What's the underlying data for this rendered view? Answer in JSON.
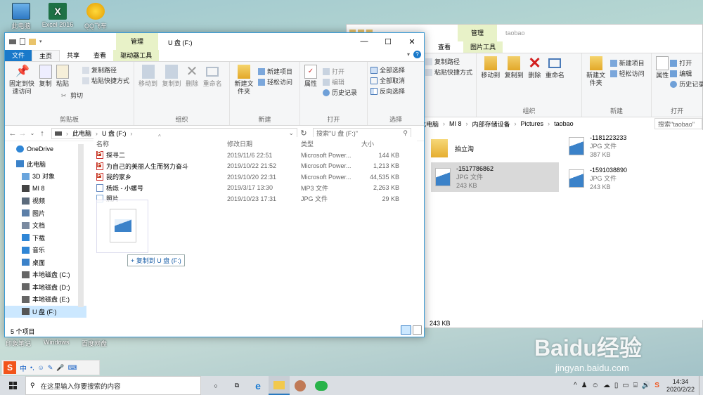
{
  "desktop": {
    "icons": [
      {
        "label": "此电脑"
      },
      {
        "label": "Excel 2016"
      },
      {
        "label": "QQ飞车"
      }
    ],
    "bottom_labels": [
      "印象笔记",
      "Windows",
      "百度网盘"
    ]
  },
  "front_window": {
    "quick_title": "U 盘 (F:)",
    "context_tab": "管理",
    "tabs": [
      "文件",
      "主页",
      "共享",
      "查看",
      "驱动器工具"
    ],
    "ribbon": {
      "clipboard": {
        "pin": "固定到快速访问",
        "copy": "复制",
        "paste": "粘贴",
        "copy_path": "复制路径",
        "paste_shortcut": "粘贴快捷方式",
        "cut": "剪切",
        "label": "剪贴板"
      },
      "organize": {
        "move_to": "移动到",
        "copy_to": "复制到",
        "delete": "删除",
        "rename": "重命名",
        "label": "组织"
      },
      "new": {
        "new_folder": "新建文件夹",
        "new_item": "新建项目",
        "easy_access": "轻松访问",
        "label": "新建"
      },
      "open": {
        "properties": "属性",
        "open": "打开",
        "edit": "编辑",
        "history": "历史记录",
        "label": "打开"
      },
      "select": {
        "select_all": "全部选择",
        "select_none": "全部取消",
        "invert": "反向选择",
        "label": "选择"
      }
    },
    "address": {
      "parts": [
        "此电脑",
        "U 盘 (F:)"
      ],
      "search_placeholder": "搜索\"U 盘 (F:)\""
    },
    "nav": [
      {
        "label": "OneDrive",
        "icon": "cloud-icon"
      },
      {
        "label": "此电脑",
        "icon": "pc-icon"
      },
      {
        "label": "3D 对象",
        "icon": "cube-icon"
      },
      {
        "label": "MI 8",
        "icon": "phone-icon"
      },
      {
        "label": "视频",
        "icon": "video-icon"
      },
      {
        "label": "图片",
        "icon": "picture-icon"
      },
      {
        "label": "文档",
        "icon": "document-icon"
      },
      {
        "label": "下载",
        "icon": "download-icon"
      },
      {
        "label": "音乐",
        "icon": "music-icon"
      },
      {
        "label": "桌面",
        "icon": "desktop-icon"
      },
      {
        "label": "本地磁盘 (C:)",
        "icon": "drive-icon"
      },
      {
        "label": "本地磁盘 (D:)",
        "icon": "drive-icon"
      },
      {
        "label": "本地磁盘 (E:)",
        "icon": "drive-icon"
      },
      {
        "label": "U 盘 (F:)",
        "icon": "usb-drive-icon"
      }
    ],
    "columns": {
      "name": "名称",
      "date": "修改日期",
      "type": "类型",
      "size": "大小"
    },
    "files": [
      {
        "name": "探寻二",
        "date": "2019/11/6 22:51",
        "type": "Microsoft Power...",
        "size": "144 KB",
        "kind": "ppt"
      },
      {
        "name": "为自己的美丽人生而努力奋斗",
        "date": "2019/10/22 21:52",
        "type": "Microsoft Power...",
        "size": "1,213 KB",
        "kind": "ppt"
      },
      {
        "name": "我的家乡",
        "date": "2019/10/20 22:31",
        "type": "Microsoft Power...",
        "size": "44,535 KB",
        "kind": "ppt"
      },
      {
        "name": "杨烁 - 小螺号",
        "date": "2019/3/17 13:30",
        "type": "MP3 文件",
        "size": "2,263 KB",
        "kind": "mp3"
      },
      {
        "name": "照片",
        "date": "2019/10/23 17:31",
        "type": "JPG 文件",
        "size": "29 KB",
        "kind": "jpg"
      }
    ],
    "drag_tooltip": "+ 复制到 U 盘 (F:)",
    "status": "5 个项目"
  },
  "back_window": {
    "title": "taobao",
    "context_tab": "管理",
    "tabs": [
      "查看",
      "图片工具"
    ],
    "ribbon": {
      "copy_path": "复制路径",
      "paste_shortcut": "粘贴快捷方式",
      "move_to": "移动到",
      "copy_to": "复制到",
      "delete": "删除",
      "rename": "重命名",
      "new_folder": "新建文件夹",
      "new_item": "新建项目",
      "easy_access": "轻松访问",
      "properties": "属性",
      "open": "打开",
      "edit": "编辑",
      "history": "历史记录",
      "organize_label": "组织",
      "new_label": "新建",
      "open_label": "打开"
    },
    "address": {
      "parts": [
        "此电脑",
        "MI 8",
        "内部存储设备",
        "Pictures",
        "taobao"
      ],
      "search_placeholder": "搜索\"taobao\""
    },
    "items": [
      {
        "name": "拍立淘",
        "type": "",
        "size": "",
        "kind": "folder"
      },
      {
        "name": "-1181223233",
        "type": "JPG 文件",
        "size": "387 KB",
        "kind": "jpg"
      },
      {
        "name": "-1517786862",
        "type": "JPG 文件",
        "size": "243 KB",
        "kind": "jpg"
      },
      {
        "name": "-1591038890",
        "type": "JPG 文件",
        "size": "243 KB",
        "kind": "jpg"
      }
    ],
    "status": "243 KB"
  },
  "ime_bar": {
    "lang": "中"
  },
  "taskbar": {
    "search_placeholder": "在这里输入你要搜索的内容",
    "time": "14:34",
    "date": "2020/2/22"
  },
  "watermark": {
    "text": "Baidu经验",
    "url": "jingyan.baidu.com"
  },
  "colors": {
    "accent": "#2a7ac0",
    "context_tab": "#e8f2c8",
    "selection": "#cce8ff"
  }
}
